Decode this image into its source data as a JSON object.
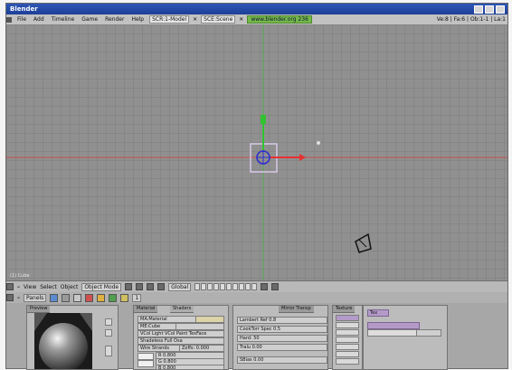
{
  "window": {
    "title": "Blender"
  },
  "info_header": {
    "menus": [
      "File",
      "Add",
      "Timeline",
      "Game",
      "Render",
      "Help"
    ],
    "screen_field": "SCR:1-Model",
    "scene_field": "SCE:Scene",
    "url": "www.blender.org 236",
    "stats": "Ve:8 | Fa:6 | Ob:1-1 | La:1"
  },
  "viewport": {
    "object_name": "(1) Cube"
  },
  "view_header": {
    "menus": [
      "View",
      "Select",
      "Object"
    ],
    "mode": "Object Mode",
    "orientation": "Global"
  },
  "buttons_header": {
    "panel_menu": "Panels",
    "frame": "1"
  },
  "buttons": {
    "preview_tab": "Preview",
    "material_tab": "Material",
    "shaders_tab": "Shaders",
    "mirror_tab": "Mirror Transp",
    "texture_tab": "Texture",
    "material_name": "MA:Material",
    "me_field": "ME:Cube",
    "vcol_row": "VCol Light  VCol Paint  TexFace",
    "shadeless_row": "Shadeless  Full Osa",
    "wire_row": "Wire  Strands",
    "zoffs_row": "Zoffs: 0.000",
    "shader_rows": [
      "Lambert  Ref 0.8",
      "CookTorr  Spec 0.5",
      "Hard: 50",
      "Tralu 0.00",
      "SBias 0.00"
    ],
    "sliders": [
      "R 0.800",
      "G 0.800",
      "B 0.800"
    ],
    "tex_slot": "Tex"
  }
}
